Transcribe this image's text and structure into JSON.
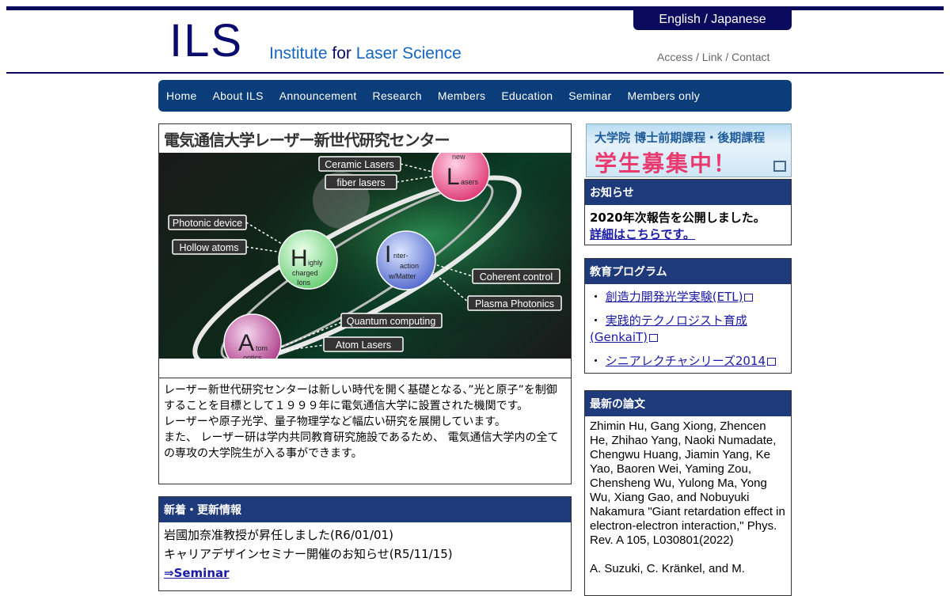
{
  "header": {
    "lang_switch": "English / Japanese",
    "logo_short": "ILS",
    "logo_full_1": "Institute ",
    "logo_full_for": "for",
    "logo_full_2": " Laser Science",
    "util_access": "Access",
    "util_sep1": " / ",
    "util_link": "Link",
    "util_sep2": " / ",
    "util_contact": "Contact"
  },
  "nav": [
    "Home",
    "About ILS",
    "Announcement",
    "Research",
    "Members",
    "Education",
    "Seminar",
    "Members only"
  ],
  "hero": {
    "title": "電気通信大学レーザー新世代研究センター",
    "labels": {
      "ceramic": "Ceramic Lasers",
      "fiber": "fiber lasers",
      "photonic": "Photonic device",
      "hollow": "Hollow atoms",
      "coherent": "Coherent control",
      "plasma": "Plasma Photonics",
      "quantum": "Quantum computing",
      "atomlasers": "Atom Lasers"
    },
    "circles": {
      "L_small": "new",
      "L_big": "L",
      "L_rest": "asers",
      "H_big": "H",
      "H_rest1": "ighly",
      "H_rest2": "charged",
      "H_rest3": "Ions",
      "I_big": "I",
      "I_rest1": "nter-",
      "I_rest2": "action",
      "I_rest3": "w/Matter",
      "A_big": "A",
      "A_rest1": "tom",
      "A_rest2": "optics"
    },
    "text1": "レーザー新世代研究センターは新しい時代を開く基礎となる、”光と原子”を制御することを目標として１９９９年に電気通信大学に設置された機関です。",
    "text2": "レーザーや原子光学、量子物理学など幅広い研究を展開しています。",
    "text3": "また、 レーザー研は学内共同教育研究施設であるため、 電気通信大学内の全ての専攻の大学院生が入る事ができます。"
  },
  "news": {
    "heading": "新着・更新情報",
    "item1": "岩國加奈准教授が昇任しました(R6/01/01)",
    "item2": "キャリアデザインセミナー開催のお知らせ(R5/11/15)",
    "link": "⇒Seminar"
  },
  "recruit": {
    "line1": "大学院 博士前期課程・後期課程",
    "line2": "学生募集中！"
  },
  "notice": {
    "heading": "お知らせ",
    "text": "2020年次報告を公開しました。",
    "link": "詳細はこちらです。"
  },
  "edu": {
    "heading": "教育プログラム",
    "items": [
      "創造力開発光学実験(ETL)",
      "実践的テクノロジスト育成(GenkaiT)",
      "シニアレクチャシリーズ2014"
    ]
  },
  "papers": {
    "heading": "最新の論文",
    "p1": "Zhimin Hu, Gang Xiong, Zhencen He, Zhihao Yang, Naoki Numadate, Chengwu Huang, Jiamin Yang, Ke Yao, Baoren Wei, Yaming Zou, Chensheng Wu, Yulong Ma, Yong Wu, Xiang Gao, and Nobuyuki Nakamura \"Giant retardation effect in electron-electron interaction,\" Phys. Rev. A 105, L030801(2022)",
    "p2": "A. Suzuki, C. Kränkel, and M."
  },
  "colors": {
    "navy": "#0b0b5e",
    "nav_bg": "#0b3d7a",
    "box_head": "#1e3a7a",
    "link": "#1a1aa8",
    "logo_blue": "#1565c0"
  }
}
